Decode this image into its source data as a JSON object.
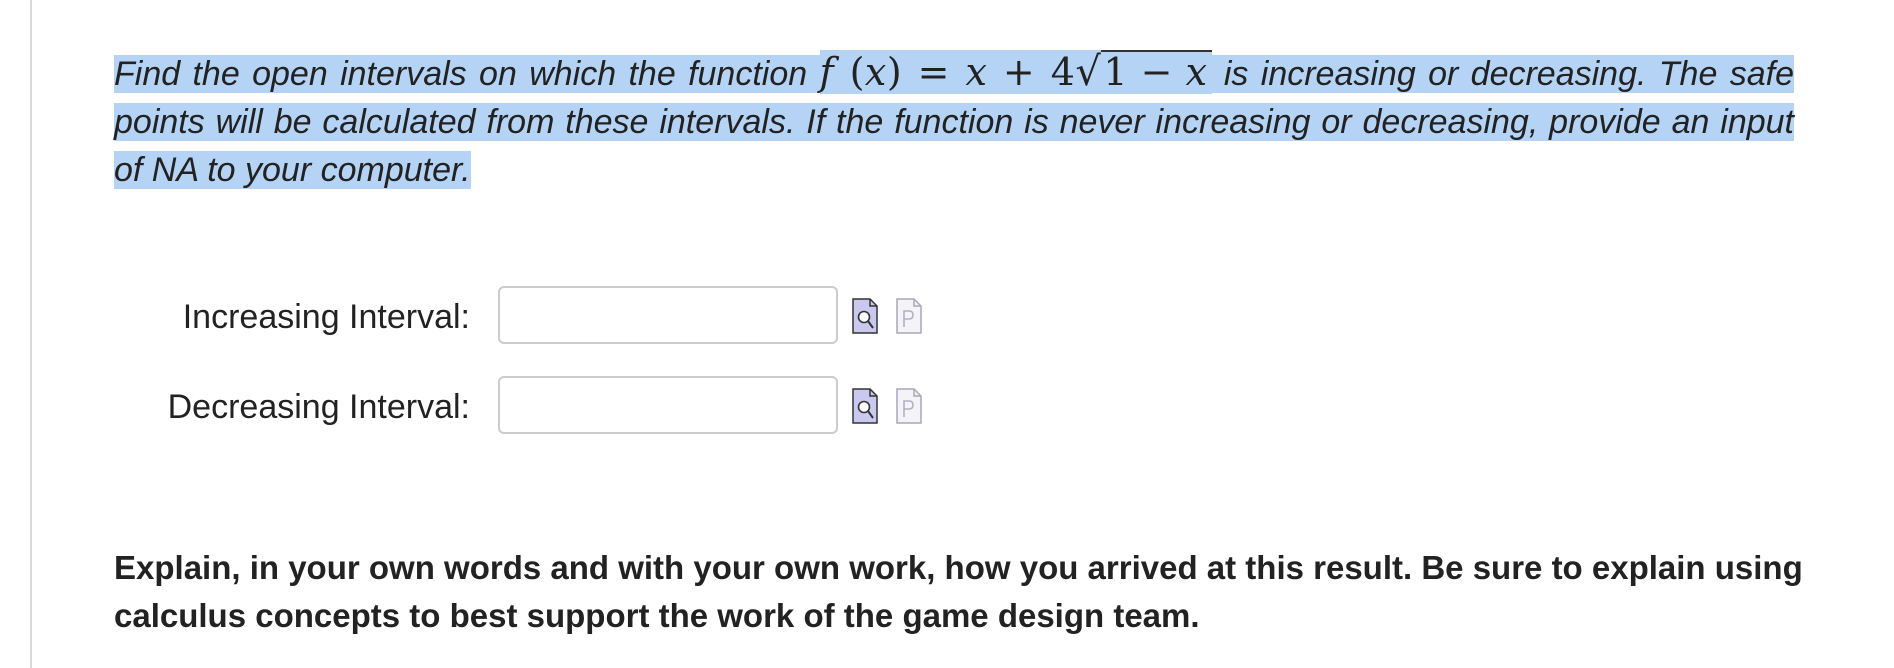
{
  "question": {
    "text_before": "Find the open intervals on which the function ",
    "math_f": "f",
    "math_open": " (",
    "math_x1": "x",
    "math_mid": ") = ",
    "math_x2": "x",
    "math_plus": " + 4",
    "math_sqrt": "√",
    "math_one": "1 − ",
    "math_x3": "x",
    "text_after": " is increasing or decreasing. The safe points will be calculated from these intervals. If the function is never increasing or decreasing, provide an input of NA to your computer."
  },
  "answers": [
    {
      "label": "Increasing Interval:",
      "value": "",
      "preview_icon": "preview-answer-icon",
      "format_icon": "format-help-icon"
    },
    {
      "label": "Decreasing Interval:",
      "value": "",
      "preview_icon": "preview-answer-icon",
      "format_icon": "format-help-icon"
    }
  ],
  "explain": {
    "text": "Explain, in your own words and with your own work, how you arrived at this result. Be sure to explain using calculus concepts to best support the work of the game design team."
  },
  "colors": {
    "selection_highlight": "#b5d3f5",
    "input_border": "#cccccc",
    "icon_fill": "#c9c9f0"
  }
}
